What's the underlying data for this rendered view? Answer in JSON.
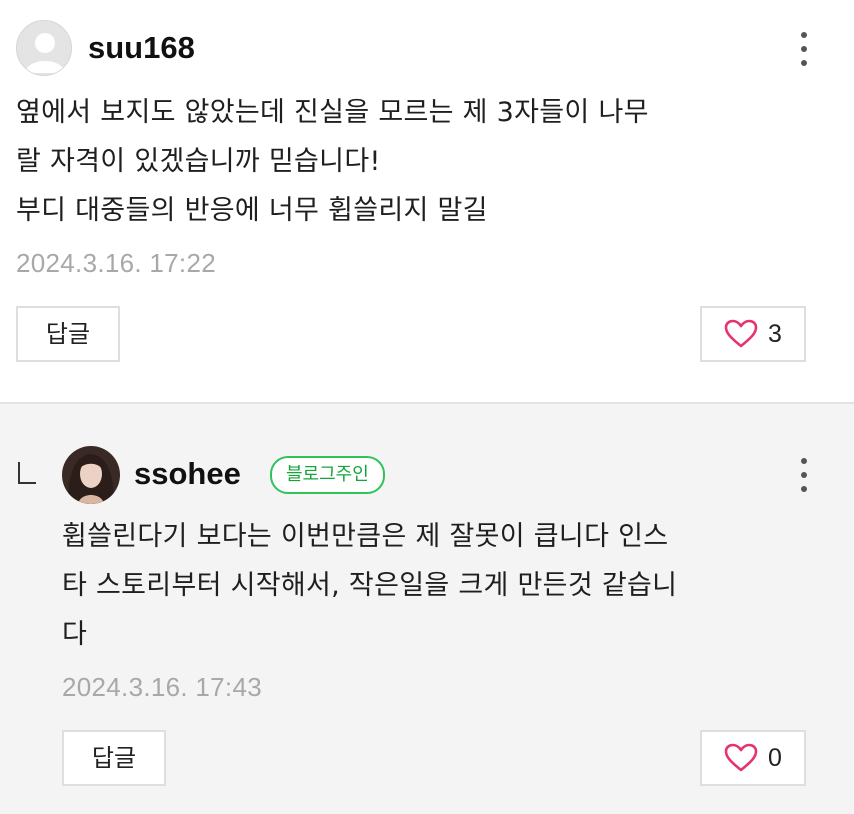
{
  "comments": [
    {
      "username": "suu168",
      "body": "옆에서 보지도 않았는데 진실을 모르는 제 3자들이 나무\n랄 자격이 있겠습니까 믿습니다!\n부디 대중들의 반응에 너무 휩쓸리지 말길",
      "timestamp": "2024.3.16. 17:22",
      "reply_label": "답글",
      "like_count": "3"
    },
    {
      "username": "ssohee",
      "badge": "블로그주인",
      "body": "휩쓸린다기 보다는 이번만큼은 제 잘못이 큽니다 인스\n타 스토리부터 시작해서, 작은일을 크게 만든것 같습니\n다",
      "timestamp": "2024.3.16. 17:43",
      "reply_label": "답글",
      "like_count": "0"
    }
  ],
  "icons": {
    "more": "more-vertical-icon",
    "heart": "heart-outline-icon",
    "reply_indicator": "reply-corner-icon"
  },
  "colors": {
    "heart": "#e6336b",
    "badge": "#2fc35a",
    "timestamp": "#a8a8a8",
    "reply_background": "#f4f4f4"
  }
}
